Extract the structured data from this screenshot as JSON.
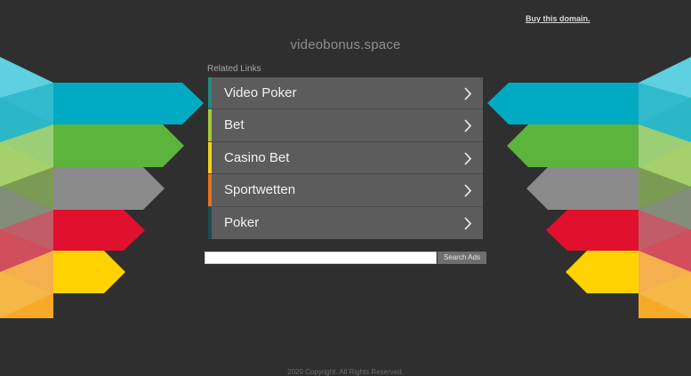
{
  "header": {
    "buy_domain_label": "Buy this domain.",
    "domain_name": "videobonus.space"
  },
  "related": {
    "label": "Related Links",
    "items": [
      {
        "label": "Video Poker",
        "accent": "#1f8a82"
      },
      {
        "label": "Bet",
        "accent": "#a6c93a"
      },
      {
        "label": "Casino Bet",
        "accent": "#f4d21c"
      },
      {
        "label": "Sportwetten",
        "accent": "#e4741e"
      },
      {
        "label": "Poker",
        "accent": "#1d4b52"
      }
    ]
  },
  "search": {
    "input_value": "",
    "button_label": "Search Ads"
  },
  "footer": {
    "copyright": "2020 Copyright. All Rights Reserved."
  },
  "decoration": {
    "stripe_colors": [
      "#00aac3",
      "#5cb43c",
      "#8a8a8a",
      "#e0102e",
      "#ffd200"
    ],
    "background": "#2f2f2f",
    "chevron_icon": "chevron-right-icon"
  }
}
